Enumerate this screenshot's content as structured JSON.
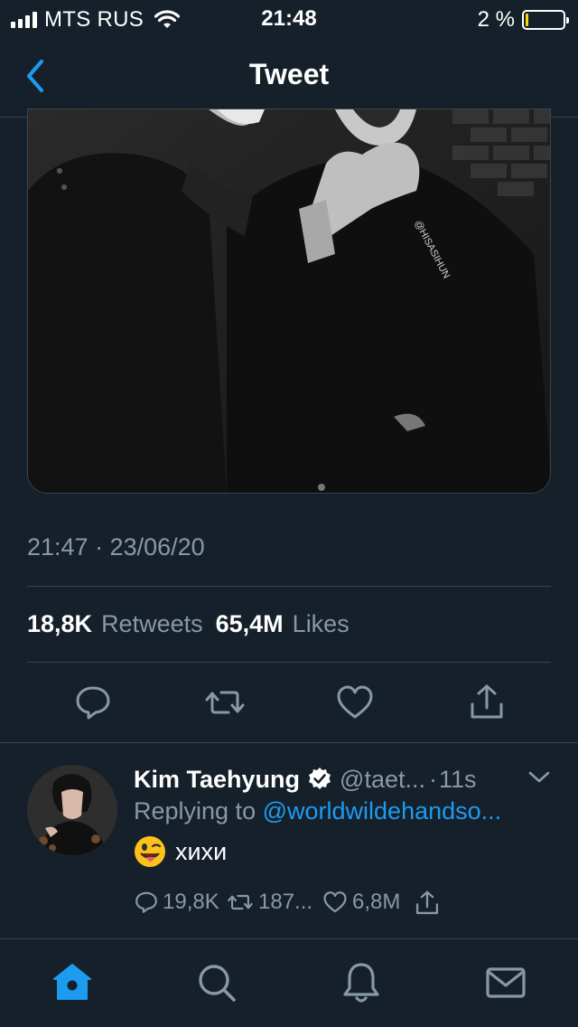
{
  "status_bar": {
    "carrier": "MTS RUS",
    "time": "21:48",
    "battery": "2 %",
    "battery_level": 0.02,
    "battery_color": "#ffd60a",
    "icons": [
      "signal-icon",
      "wifi-icon",
      "battery-icon"
    ]
  },
  "nav": {
    "title": "Tweet",
    "back_icon": "chevron-left-icon"
  },
  "tweet": {
    "media_watermark": "@HISASIHUN",
    "timestamp": "21:47 · 23/06/20",
    "retweets_count": "18,8K",
    "retweets_label": "Retweets",
    "likes_count": "65,4M",
    "likes_label": "Likes",
    "actions": [
      "reply-icon",
      "retweet-icon",
      "like-icon",
      "share-icon"
    ]
  },
  "reply": {
    "name": "Kim Taehyung",
    "handle": "@taet...",
    "dot": "·",
    "time": "11s",
    "replying_prefix": "Replying to",
    "replying_mention": "@worldwildehandso...",
    "emoji": "winking-face-with-tongue",
    "text": "хихи",
    "replies": "19,8K",
    "retweets": "187...",
    "likes": "6,8M"
  },
  "tab_bar": {
    "tabs": [
      "home-icon",
      "search-icon",
      "notifications-icon",
      "messages-icon"
    ],
    "active": "home-icon"
  },
  "colors": {
    "background": "#15202b",
    "divider": "#38444d",
    "accent": "#1d9bf0",
    "muted": "#8899a6",
    "text": "#ffffff"
  }
}
